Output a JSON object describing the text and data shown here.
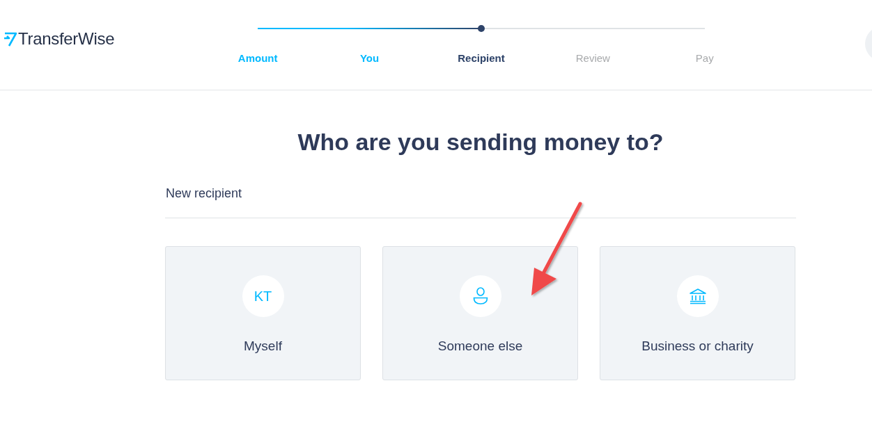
{
  "logo": {
    "text": "TransferWise"
  },
  "progress": {
    "level": 0.5
  },
  "steps": [
    {
      "label": "Amount",
      "done": true,
      "selected": false
    },
    {
      "label": "You",
      "done": true,
      "selected": false
    },
    {
      "label": "Recipient",
      "done": false,
      "selected": true
    },
    {
      "label": "Review",
      "done": false,
      "selected": false
    },
    {
      "label": "Pay",
      "done": false,
      "selected": false
    }
  ],
  "heading": "Who are you sending money to?",
  "section_title": "New recipient",
  "options": [
    {
      "label": "Myself",
      "kind": "initials",
      "initials": "KT"
    },
    {
      "label": "Someone else",
      "kind": "person"
    },
    {
      "label": "Business or charity",
      "kind": "bank"
    }
  ]
}
